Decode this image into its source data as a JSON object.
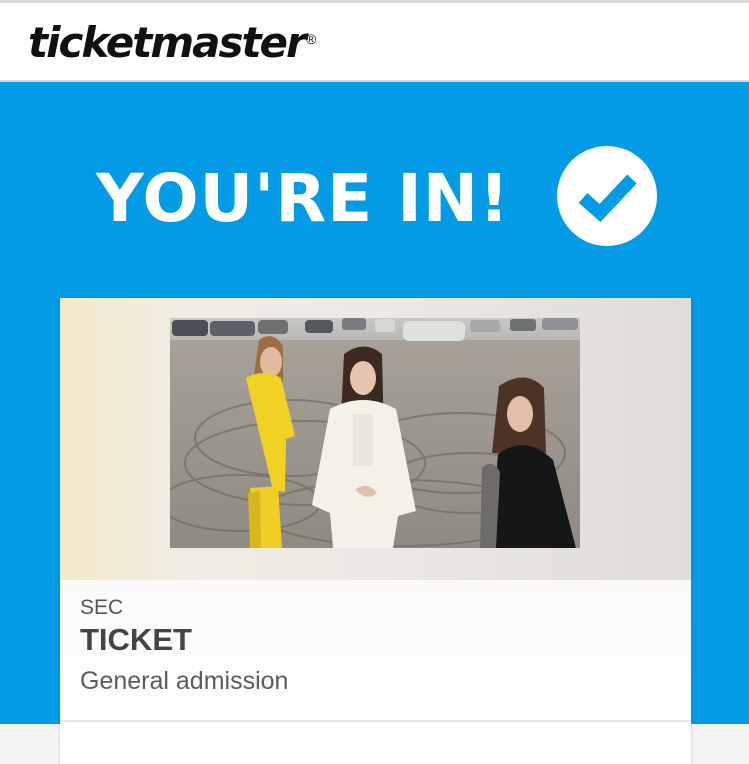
{
  "header": {
    "logo_text": "ticketmaster",
    "registered_mark": "®"
  },
  "banner": {
    "headline": "YOU'RE IN!",
    "check_icon": "checkmark-circle-icon"
  },
  "ticket_card": {
    "section_label": "SEC",
    "ticket_label": "TICKET",
    "admission_type": "General admission"
  },
  "colors": {
    "banner_blue": "#039be5",
    "header_bg": "#ffffff",
    "text_dark": "#444444"
  }
}
